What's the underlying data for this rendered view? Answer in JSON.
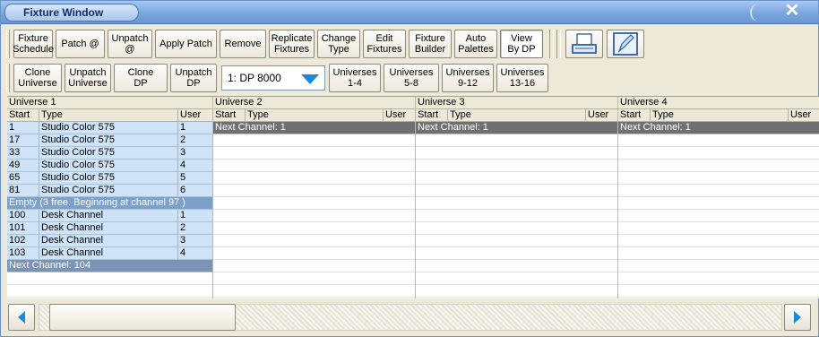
{
  "window": {
    "title": "Fixture Window"
  },
  "toolbar1": {
    "buttons": [
      {
        "label": "Fixture\nSchedule"
      },
      {
        "label": "Patch @"
      },
      {
        "label": "Unpatch\n@"
      },
      {
        "label": "Apply Patch"
      },
      {
        "label": "Remove"
      },
      {
        "label": "Replicate\nFixtures"
      },
      {
        "label": "Change\nType"
      },
      {
        "label": "Edit\nFixtures"
      },
      {
        "label": "Fixture\nBuilder"
      },
      {
        "label": "Auto\nPalettes"
      },
      {
        "label": "View\nBy DP"
      }
    ],
    "icons": [
      "printer-icon",
      "editor-window-icon"
    ]
  },
  "toolbar2": {
    "buttons": [
      {
        "label": "Clone\nUniverse"
      },
      {
        "label": "Unpatch\nUniverse"
      },
      {
        "label": "Clone\nDP"
      },
      {
        "label": "Unpatch\nDP"
      }
    ],
    "dp_select": "1: DP 8000",
    "universe_buttons": [
      {
        "label": "Universes\n1-4"
      },
      {
        "label": "Universes\n5-8"
      },
      {
        "label": "Universes\n9-12"
      },
      {
        "label": "Universes\n13-16"
      }
    ]
  },
  "grid": {
    "columns": {
      "start": "Start",
      "type": "Type",
      "user": "User"
    },
    "universes": [
      {
        "name": "Universe 1",
        "rows": [
          {
            "start": "1",
            "type": "Studio Color 575",
            "user": "1"
          },
          {
            "start": "17",
            "type": "Studio Color 575",
            "user": "2"
          },
          {
            "start": "33",
            "type": "Studio Color 575",
            "user": "3"
          },
          {
            "start": "49",
            "type": "Studio Color 575",
            "user": "4"
          },
          {
            "start": "65",
            "type": "Studio Color 575",
            "user": "5"
          },
          {
            "start": "81",
            "type": "Studio Color 575",
            "user": "6"
          }
        ],
        "empty": "Empty (3 free. Beginning at channel 97 )",
        "rows2": [
          {
            "start": "100",
            "type": "Desk Channel",
            "user": "1"
          },
          {
            "start": "101",
            "type": "Desk Channel",
            "user": "2"
          },
          {
            "start": "102",
            "type": "Desk Channel",
            "user": "3"
          },
          {
            "start": "103",
            "type": "Desk Channel",
            "user": "4"
          }
        ],
        "next": "Next Channel: 104"
      },
      {
        "name": "Universe 2",
        "next": "Next Channel: 1"
      },
      {
        "name": "Universe 3",
        "next": "Next Channel: 1"
      },
      {
        "name": "Universe 4",
        "next": "Next Channel: 1"
      }
    ]
  },
  "colors": {
    "title_bar": "#7aa6de",
    "row_selected": "#cfe3f7",
    "empty_bar": "#7da0c9",
    "next_bar": "#707070"
  }
}
